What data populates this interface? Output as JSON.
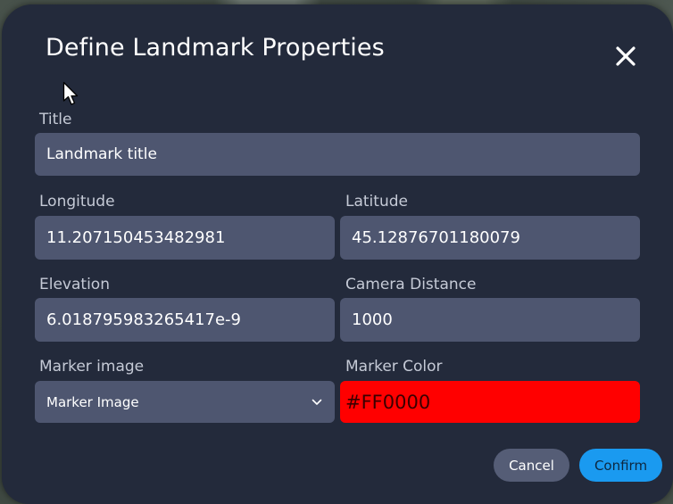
{
  "dialog": {
    "title": "Define Landmark Properties",
    "close_icon": "close-icon"
  },
  "fields": {
    "title": {
      "label": "Title",
      "value": "Landmark title"
    },
    "longitude": {
      "label": "Longitude",
      "value": "11.207150453482981"
    },
    "latitude": {
      "label": "Latitude",
      "value": "45.12876701180079"
    },
    "elevation": {
      "label": "Elevation",
      "value": "6.018795983265417e-9"
    },
    "camera_distance": {
      "label": "Camera Distance",
      "value": "1000"
    },
    "marker_image": {
      "label": "Marker image",
      "value": "Marker Image",
      "icon": "chevron-down-icon"
    },
    "marker_color": {
      "label": "Marker Color",
      "value": "#FF0000",
      "color": "#FF0000"
    }
  },
  "buttons": {
    "cancel": "Cancel",
    "confirm": "Confirm"
  },
  "colors": {
    "dialog_bg": "#232A3B",
    "field_bg": "#4E5670",
    "confirm_bg": "#1A9AF0",
    "cancel_bg": "#555D76"
  }
}
